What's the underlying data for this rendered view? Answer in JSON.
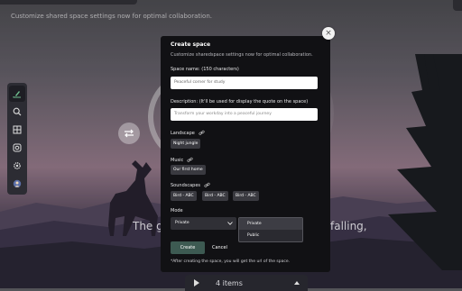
{
  "background": {
    "tagline": "Customize shared space settings now for optimal collaboration.",
    "quote_left": "The g",
    "quote_right": "falling,",
    "player_items": "4 items"
  },
  "sidebar": {
    "items": [
      {
        "icon": "edit-icon"
      },
      {
        "icon": "search-icon"
      },
      {
        "icon": "grid-icon"
      },
      {
        "icon": "instagram-icon"
      },
      {
        "icon": "gear-icon"
      },
      {
        "icon": "user-icon"
      }
    ]
  },
  "modal": {
    "title": "Create space",
    "subtitle": "Customize sharedspace settings now for optimal collaboration.",
    "name_label": "Space name: (150 characters)",
    "name_value": "Peaceful corner for study",
    "description_label": "Description: (It'll be used for display the quote on the space)",
    "description_placeholder": "Transform your workday into a peaceful journey",
    "landscape_label": "Landscape",
    "landscape_value": "Night jungle",
    "music_label": "Music",
    "music_value": "Our first home",
    "soundscapes_label": "Soundscapes",
    "soundscapes": [
      "Bird - ABC",
      "Bird - ABC",
      "Bird - ABC"
    ],
    "mode_label": "Mode",
    "mode_value": "Private",
    "mode_options": [
      "Private",
      "Public"
    ],
    "create_label": "Create",
    "cancel_label": "Cancel",
    "note": "*After creating the space, you will get the url of the space.",
    "close_label": "×"
  },
  "colors": {
    "accent": "#3d5a52",
    "modal_bg": "#111114"
  }
}
